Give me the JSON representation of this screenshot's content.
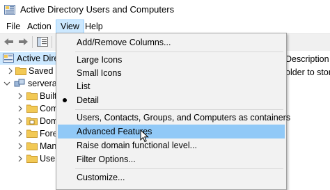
{
  "window": {
    "title": "Active Directory Users and Computers",
    "icon": "active-directory-icon"
  },
  "menubar": {
    "items": [
      "File",
      "Action",
      "View",
      "Help"
    ],
    "open_item": "View"
  },
  "toolbar": {
    "buttons": [
      "back-icon",
      "forward-icon",
      "console-tree-icon"
    ]
  },
  "tree": {
    "items": [
      {
        "label": "Active Directo",
        "icon": "active-directory-icon",
        "expander": "collapsed",
        "selected": true
      },
      {
        "label": "Saved Q",
        "icon": "folder-icon",
        "expander": "collapsed"
      },
      {
        "label": "serverac",
        "icon": "domain-icon",
        "expander": "expanded"
      },
      {
        "label": "Built",
        "icon": "folder-icon",
        "expander": "collapsed"
      },
      {
        "label": "Com",
        "icon": "folder-icon",
        "expander": "collapsed"
      },
      {
        "label": "Dom",
        "icon": "ou-folder-icon",
        "expander": "collapsed"
      },
      {
        "label": "Fore",
        "icon": "folder-icon",
        "expander": "collapsed"
      },
      {
        "label": "Man",
        "icon": "folder-icon",
        "expander": "collapsed"
      },
      {
        "label": "User",
        "icon": "folder-icon",
        "expander": "collapsed"
      }
    ]
  },
  "right_pane": {
    "column_header": "Description",
    "row_text": "older to store"
  },
  "view_menu": {
    "items": [
      {
        "label": "Add/Remove Columns..."
      },
      {
        "label": "Large Icons"
      },
      {
        "label": "Small Icons"
      },
      {
        "label": "List"
      },
      {
        "label": "Detail",
        "checked": true
      },
      {
        "label": "Users, Contacts, Groups, and Computers as containers"
      },
      {
        "label": "Advanced Features",
        "highlighted": true
      },
      {
        "label": "Raise domain functional level..."
      },
      {
        "label": "Filter Options..."
      },
      {
        "label": "Customize..."
      }
    ]
  },
  "colors": {
    "menu_highlight": "#91c9f7",
    "selection": "#cce8ff",
    "folder": "#f2c955"
  }
}
